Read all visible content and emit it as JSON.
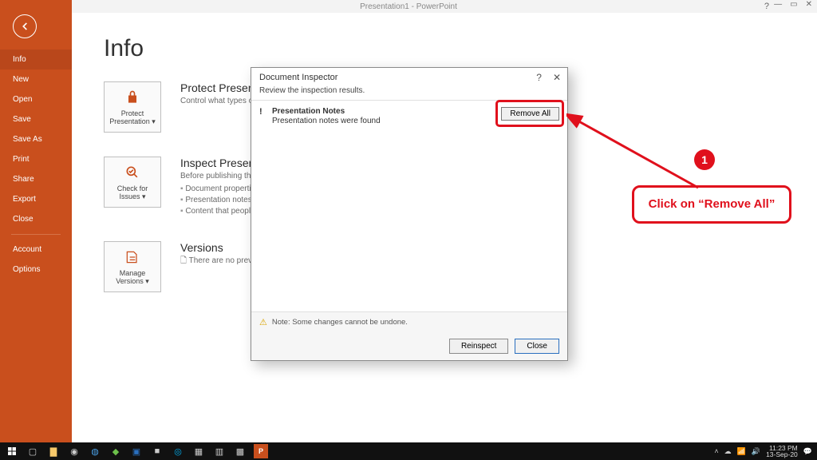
{
  "titlebar": {
    "title": "Presentation1 - PowerPoint",
    "help": "?",
    "min": "—",
    "max": "▭",
    "close": "✕"
  },
  "sidebar": {
    "items": [
      "Info",
      "New",
      "Open",
      "Save",
      "Save As",
      "Print",
      "Share",
      "Export",
      "Close"
    ],
    "bottom": [
      "Account",
      "Options"
    ],
    "active_index": 0
  },
  "main": {
    "heading": "Info",
    "sections": [
      {
        "tile": "Protect\nPresentation ▾",
        "title": "Protect Presentation",
        "desc": "Control what types of changes people can make to this presentation.",
        "bullets": []
      },
      {
        "tile": "Check for\nIssues ▾",
        "title": "Inspect Presentation",
        "desc": "Before publishing this file, be aware that it contains:",
        "bullets": [
          "Document properties and author's name",
          "Presentation notes",
          "Content that people with disabilities are unable to read"
        ]
      },
      {
        "tile": "Manage\nVersions ▾",
        "title": "Versions",
        "desc": "There are no previous versions of this file.",
        "bullets": []
      }
    ]
  },
  "modal": {
    "title": "Document Inspector",
    "subtitle": "Review the inspection results.",
    "result": {
      "mark": "!",
      "heading": "Presentation Notes",
      "detail": "Presentation notes were found"
    },
    "remove_btn": "Remove All",
    "note": "Note: Some changes cannot be undone.",
    "reinspect": "Reinspect",
    "close_btn": "Close"
  },
  "annotation": {
    "num": "1",
    "text": "Click on “Remove All”"
  },
  "taskbar": {
    "time": "11:23 PM",
    "date": "13-Sep-20"
  }
}
